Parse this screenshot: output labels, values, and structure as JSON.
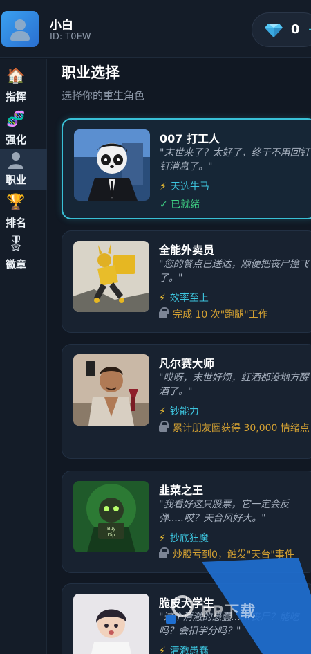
{
  "header": {
    "username": "小白",
    "user_id": "ID: T0EW",
    "gems": "0",
    "gem_plus": "+",
    "gem_icon": "diamond-icon"
  },
  "sidebar": {
    "items": [
      {
        "label": "指挥",
        "icon": "house-icon",
        "active": false
      },
      {
        "label": "强化",
        "icon": "dna-icon",
        "active": false
      },
      {
        "label": "职业",
        "icon": "user-icon",
        "active": true
      },
      {
        "label": "排名",
        "icon": "trophy-icon",
        "active": false
      },
      {
        "label": "徽章",
        "icon": "medal-icon",
        "active": false
      }
    ]
  },
  "main": {
    "title": "职业选择",
    "subtitle": "选择你的重生角色",
    "careers": [
      {
        "name": "007 打工人",
        "quote": "\"末世来了？太好了，终于不用回钉钉消息了。\"",
        "perk": "天选牛马",
        "status": "✓ 已就绪",
        "unlocked": true
      },
      {
        "name": "全能外卖员",
        "quote": "\"您的餐点已送达，顺便把丧尸撞飞了。\"",
        "perk": "效率至上",
        "status": "完成 10 次\"跑腿\"工作",
        "unlocked": false
      },
      {
        "name": "凡尔赛大师",
        "quote": "\"哎呀，末世好烦，红酒都没地方醒酒了。\"",
        "perk": "钞能力",
        "status": "累计朋友圈获得 30,000 情绪点",
        "unlocked": false
      },
      {
        "name": "韭菜之王",
        "quote": "\"我看好这只股票，它一定会反弹.....哎？天台风好大。\"",
        "perk": "抄底狂魔",
        "status": "炒股亏到0，触发\"天台\"事件",
        "unlocked": false
      },
      {
        "name": "脆皮大学生",
        "quote": "\"这个清澈的愚蠢……丧尸？能吃吗？会扣学分吗？\"",
        "perk": "清澈愚蠢",
        "status": "",
        "unlocked": false
      }
    ]
  },
  "watermark": {
    "text": "PP下载"
  },
  "colors": {
    "accent": "#39c0d6",
    "ready": "#3fd184",
    "locked": "#d4a132",
    "bolt": "#f2c232"
  }
}
